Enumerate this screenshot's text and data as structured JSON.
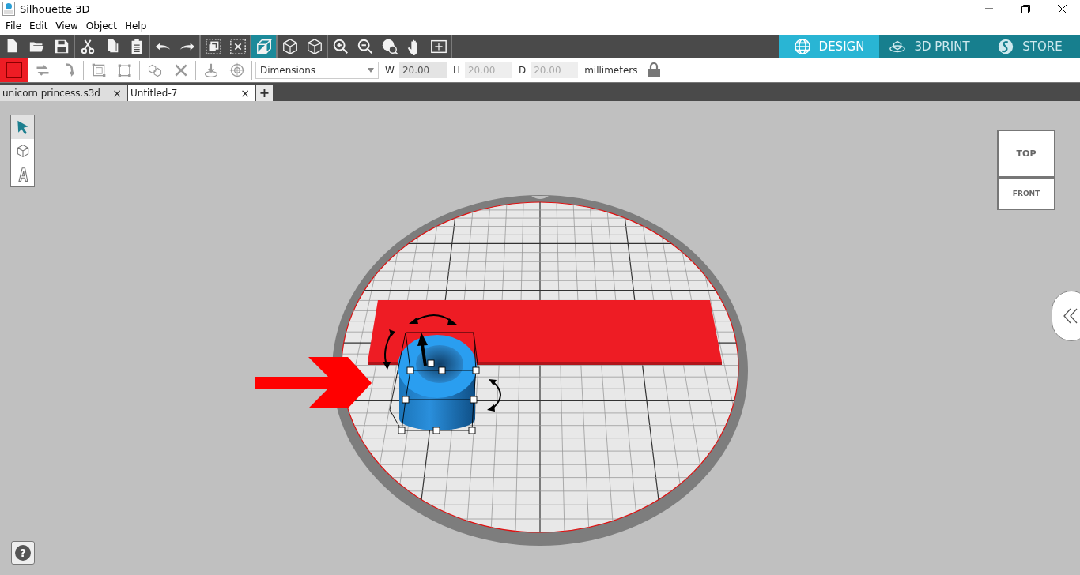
{
  "window": {
    "title": "Silhouette 3D"
  },
  "menu": [
    "File",
    "Edit",
    "View",
    "Object",
    "Help"
  ],
  "toolbar": [
    [
      {
        "kind": "new",
        "selected": false
      },
      {
        "kind": "open",
        "selected": false
      },
      {
        "kind": "save",
        "selected": false
      }
    ],
    [
      {
        "kind": "cut",
        "selected": false
      },
      {
        "kind": "copy",
        "selected": false
      },
      {
        "kind": "paste",
        "selected": false
      }
    ],
    [
      {
        "kind": "undo",
        "selected": false
      },
      {
        "kind": "redo",
        "selected": false
      }
    ],
    [
      {
        "kind": "group",
        "selected": false
      },
      {
        "kind": "ungroup",
        "selected": false
      }
    ],
    [
      {
        "kind": "perspective",
        "selected": true
      }
    ],
    [
      {
        "kind": "cube",
        "selected": false
      },
      {
        "kind": "cube-top",
        "selected": false
      }
    ],
    [
      {
        "kind": "zoom-in",
        "selected": false
      },
      {
        "kind": "zoom-out",
        "selected": false
      },
      {
        "kind": "zoom-select",
        "selected": false
      },
      {
        "kind": "pan",
        "selected": false
      },
      {
        "kind": "fit",
        "selected": false
      }
    ]
  ],
  "modes": [
    {
      "label": "DESIGN",
      "kind": "globe",
      "selected": true
    },
    {
      "label": "3D PRINT",
      "kind": "printer",
      "selected": false
    },
    {
      "label": "STORE",
      "kind": "store",
      "selected": false
    }
  ],
  "properties": {
    "color": "#ee1c24",
    "tools": [
      [
        {
          "kind": "flip-h"
        },
        {
          "kind": "flip-v"
        }
      ],
      [
        {
          "kind": "align"
        },
        {
          "kind": "distribute"
        }
      ],
      [
        {
          "kind": "combine"
        },
        {
          "kind": "delete"
        }
      ],
      [
        {
          "kind": "drop"
        },
        {
          "kind": "center"
        }
      ]
    ],
    "dimensions": "Dimensions",
    "fields": [
      {
        "label": "W",
        "value": "20.00",
        "disabled": false
      },
      {
        "label": "H",
        "value": "20.00",
        "disabled": true
      },
      {
        "label": "D",
        "value": "20.00",
        "disabled": true
      }
    ],
    "units": "millimeters",
    "locked": true
  },
  "documents": [
    {
      "name": "unicorn princess.s3d",
      "close": "×",
      "selected": false
    },
    {
      "name": "Untitled-7",
      "close": "×",
      "selected": true
    }
  ],
  "new_tab": "+",
  "side_tools": [
    {
      "kind": "select",
      "selected": true
    },
    {
      "kind": "shape",
      "selected": false
    },
    {
      "kind": "text",
      "selected": false
    }
  ],
  "view_cube": {
    "top": "TOP",
    "front": "FRONT"
  },
  "help": "?"
}
